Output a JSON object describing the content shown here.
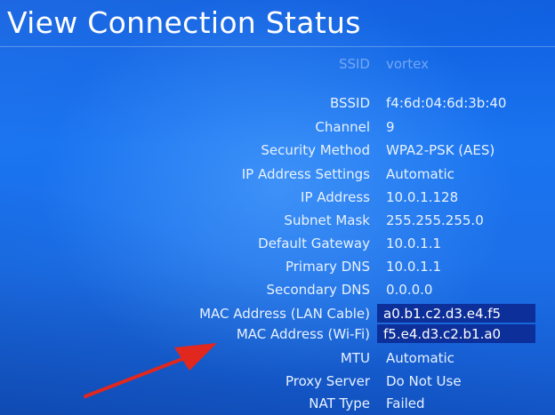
{
  "page": {
    "title": "View Connection Status"
  },
  "rows": [
    {
      "label": "SSID",
      "value": "vortex"
    },
    {
      "label": "BSSID",
      "value": "f4:6d:04:6d:3b:40"
    },
    {
      "label": "Channel",
      "value": "9"
    },
    {
      "label": "Security Method",
      "value": "WPA2-PSK (AES)"
    },
    {
      "label": "IP Address Settings",
      "value": "Automatic"
    },
    {
      "label": "IP Address",
      "value": "10.0.1.128"
    },
    {
      "label": "Subnet Mask",
      "value": "255.255.255.0"
    },
    {
      "label": "Default Gateway",
      "value": "10.0.1.1"
    },
    {
      "label": "Primary DNS",
      "value": "10.0.1.1"
    },
    {
      "label": "Secondary DNS",
      "value": "0.0.0.0"
    },
    {
      "label": "MAC Address (LAN Cable)",
      "value": "a0.b1.c2.d3.e4.f5"
    },
    {
      "label": "MAC Address (Wi-Fi)",
      "value": "f5.e4.d3.c2.b1.a0"
    },
    {
      "label": "MTU",
      "value": "Automatic"
    },
    {
      "label": "Proxy Server",
      "value": "Do Not Use"
    },
    {
      "label": "NAT Type",
      "value": "Failed"
    }
  ],
  "colors": {
    "background": "#1a74f0",
    "highlight": "#0c2f9a",
    "annotation_arrow": "#e0281e"
  },
  "annotation": {
    "icon": "red-arrow-icon",
    "target": "MAC Address (Wi-Fi)"
  }
}
